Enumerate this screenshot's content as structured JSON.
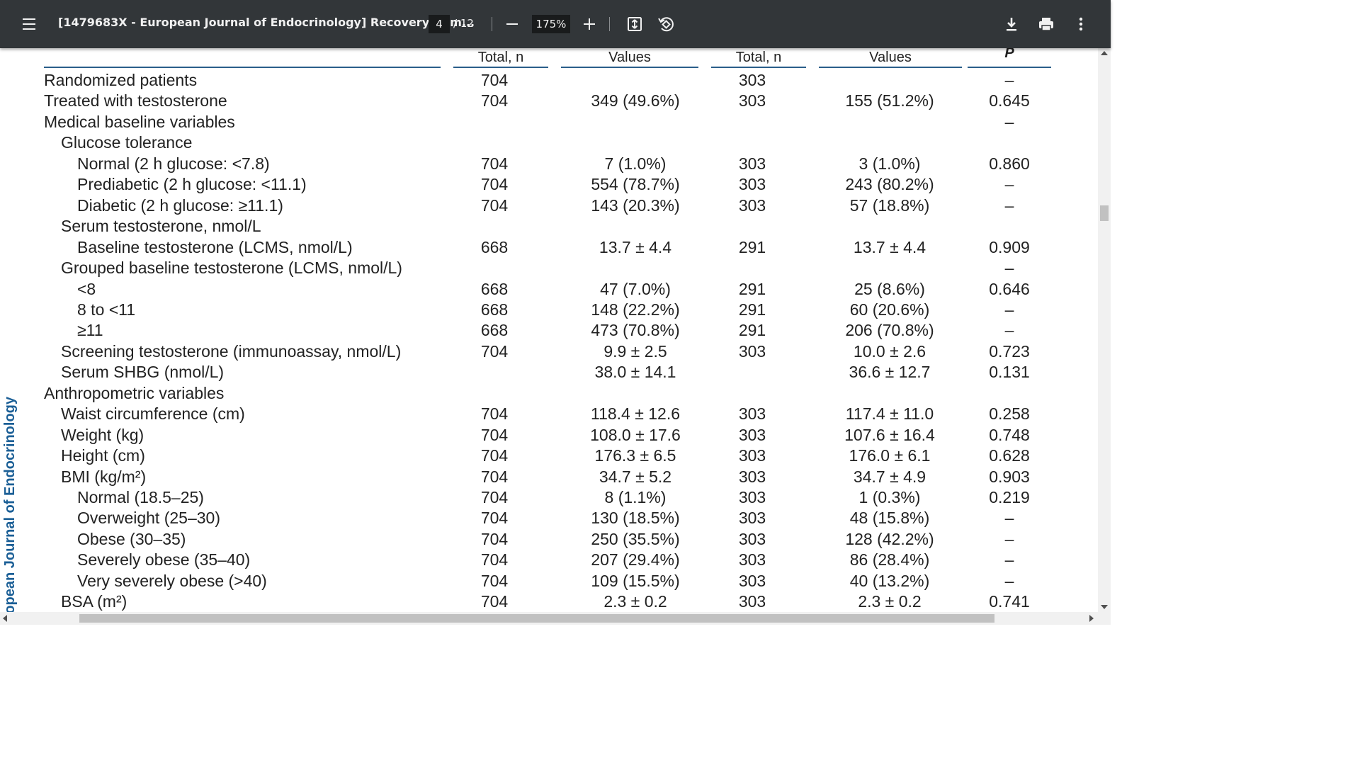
{
  "toolbar": {
    "title": "[1479683X - European Journal of Endocrinology] Recovery of m...",
    "page_current": "4",
    "page_total": "/ 12",
    "zoom": "175%"
  },
  "side_label": "European Journal of Endocrinology",
  "table": {
    "headers": [
      "Total, n",
      "Values",
      "Total, n",
      "Values",
      "P"
    ],
    "rows": [
      {
        "label": "Randomized patients",
        "indent": 0,
        "n1": "704",
        "v1": "",
        "n2": "303",
        "v2": "",
        "p": "–"
      },
      {
        "label": "Treated with testosterone",
        "indent": 0,
        "n1": "704",
        "v1": "349 (49.6%)",
        "n2": "303",
        "v2": "155 (51.2%)",
        "p": "0.645"
      },
      {
        "label": "Medical baseline variables",
        "indent": 0,
        "n1": "",
        "v1": "",
        "n2": "",
        "v2": "",
        "p": "–"
      },
      {
        "label": "Glucose tolerance",
        "indent": 1,
        "n1": "",
        "v1": "",
        "n2": "",
        "v2": "",
        "p": ""
      },
      {
        "label": "Normal (2 h glucose: <7.8)",
        "indent": 2,
        "n1": "704",
        "v1": "7 (1.0%)",
        "n2": "303",
        "v2": "3 (1.0%)",
        "p": "0.860"
      },
      {
        "label": "Prediabetic (2 h glucose: <11.1)",
        "indent": 2,
        "n1": "704",
        "v1": "554 (78.7%)",
        "n2": "303",
        "v2": "243 (80.2%)",
        "p": "–"
      },
      {
        "label": "Diabetic (2 h glucose: ≥11.1)",
        "indent": 2,
        "n1": "704",
        "v1": "143 (20.3%)",
        "n2": "303",
        "v2": "57 (18.8%)",
        "p": "–"
      },
      {
        "label": "Serum testosterone, nmol/L",
        "indent": 1,
        "n1": "",
        "v1": "",
        "n2": "",
        "v2": "",
        "p": ""
      },
      {
        "label": "Baseline testosterone (LCMS, nmol/L)",
        "indent": 2,
        "n1": "668",
        "v1": "13.7 ± 4.4",
        "n2": "291",
        "v2": "13.7 ± 4.4",
        "p": "0.909"
      },
      {
        "label": "Grouped baseline testosterone (LCMS, nmol/L)",
        "indent": 1,
        "n1": "",
        "v1": "",
        "n2": "",
        "v2": "",
        "p": "–"
      },
      {
        "label": "<8",
        "indent": 2,
        "n1": "668",
        "v1": "47 (7.0%)",
        "n2": "291",
        "v2": "25 (8.6%)",
        "p": "0.646"
      },
      {
        "label": "8 to <11",
        "indent": 2,
        "n1": "668",
        "v1": "148 (22.2%)",
        "n2": "291",
        "v2": "60 (20.6%)",
        "p": "–"
      },
      {
        "label": "≥11",
        "indent": 2,
        "n1": "668",
        "v1": "473 (70.8%)",
        "n2": "291",
        "v2": "206 (70.8%)",
        "p": "–"
      },
      {
        "label": "Screening testosterone (immunoassay, nmol/L)",
        "indent": 1,
        "n1": "704",
        "v1": "9.9 ± 2.5",
        "n2": "303",
        "v2": "10.0 ± 2.6",
        "p": "0.723"
      },
      {
        "label": "Serum SHBG (nmol/L)",
        "indent": 1,
        "n1": "",
        "v1": "38.0 ± 14.1",
        "n2": "",
        "v2": "36.6 ± 12.7",
        "p": "0.131"
      },
      {
        "label": "Anthropometric variables",
        "indent": 0,
        "n1": "",
        "v1": "",
        "n2": "",
        "v2": "",
        "p": ""
      },
      {
        "label": "Waist circumference (cm)",
        "indent": 1,
        "n1": "704",
        "v1": "118.4 ± 12.6",
        "n2": "303",
        "v2": "117.4 ± 11.0",
        "p": "0.258"
      },
      {
        "label": "Weight (kg)",
        "indent": 1,
        "n1": "704",
        "v1": "108.0 ± 17.6",
        "n2": "303",
        "v2": "107.6 ± 16.4",
        "p": "0.748"
      },
      {
        "label": "Height (cm)",
        "indent": 1,
        "n1": "704",
        "v1": "176.3 ± 6.5",
        "n2": "303",
        "v2": "176.0 ± 6.1",
        "p": "0.628"
      },
      {
        "label": "BMI (kg/m²)",
        "indent": 1,
        "n1": "704",
        "v1": "34.7 ± 5.2",
        "n2": "303",
        "v2": "34.7 ± 4.9",
        "p": "0.903"
      },
      {
        "label": "Normal (18.5–25)",
        "indent": 2,
        "n1": "704",
        "v1": "8 (1.1%)",
        "n2": "303",
        "v2": "1 (0.3%)",
        "p": "0.219"
      },
      {
        "label": "Overweight (25–30)",
        "indent": 2,
        "n1": "704",
        "v1": "130 (18.5%)",
        "n2": "303",
        "v2": "48 (15.8%)",
        "p": "–"
      },
      {
        "label": "Obese (30–35)",
        "indent": 2,
        "n1": "704",
        "v1": "250 (35.5%)",
        "n2": "303",
        "v2": "128 (42.2%)",
        "p": "–"
      },
      {
        "label": "Severely obese (35–40)",
        "indent": 2,
        "n1": "704",
        "v1": "207 (29.4%)",
        "n2": "303",
        "v2": "86 (28.4%)",
        "p": "–"
      },
      {
        "label": "Very severely obese (>40)",
        "indent": 2,
        "n1": "704",
        "v1": "109 (15.5%)",
        "n2": "303",
        "v2": "40 (13.2%)",
        "p": "–"
      },
      {
        "label": "BSA (m²)",
        "indent": 1,
        "n1": "704",
        "v1": "2.3 ± 0.2",
        "n2": "303",
        "v2": "2.3 ± 0.2",
        "p": "0.741"
      }
    ]
  }
}
